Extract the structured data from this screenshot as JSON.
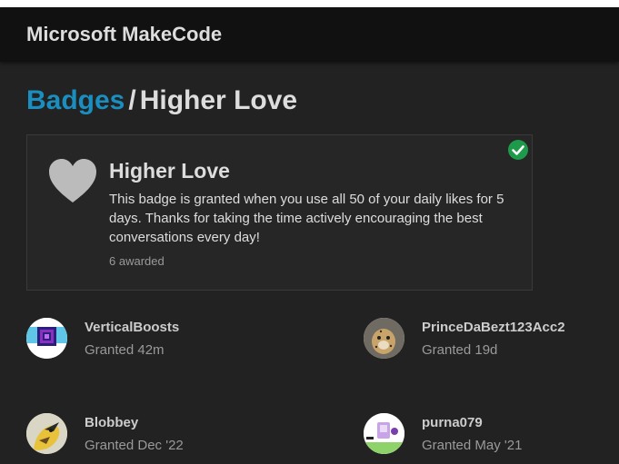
{
  "header": {
    "title": "Microsoft MakeCode"
  },
  "breadcrumb": {
    "parent": "Badges",
    "separator": "/",
    "current": "Higher Love"
  },
  "badge": {
    "name": "Higher Love",
    "description": "This badge is granted when you use all 50 of your daily likes for 5 days. Thanks for taking the time actively encouraging the best conversations every day!",
    "awarded_count": "6 awarded",
    "icon": "heart-icon",
    "status_icon": "check-circle-icon",
    "colors": {
      "accent_link": "#1a8fbf",
      "granted_check": "#1e9a4a",
      "heart": "#bbbbbb"
    }
  },
  "grantees": [
    {
      "username": "VerticalBoosts",
      "granted": "Granted 42m"
    },
    {
      "username": "PrinceDaBezt123Acc2",
      "granted": "Granted 19d"
    },
    {
      "username": "Blobbey",
      "granted": "Granted Dec '22"
    },
    {
      "username": "purna079",
      "granted": "Granted May '21"
    }
  ]
}
